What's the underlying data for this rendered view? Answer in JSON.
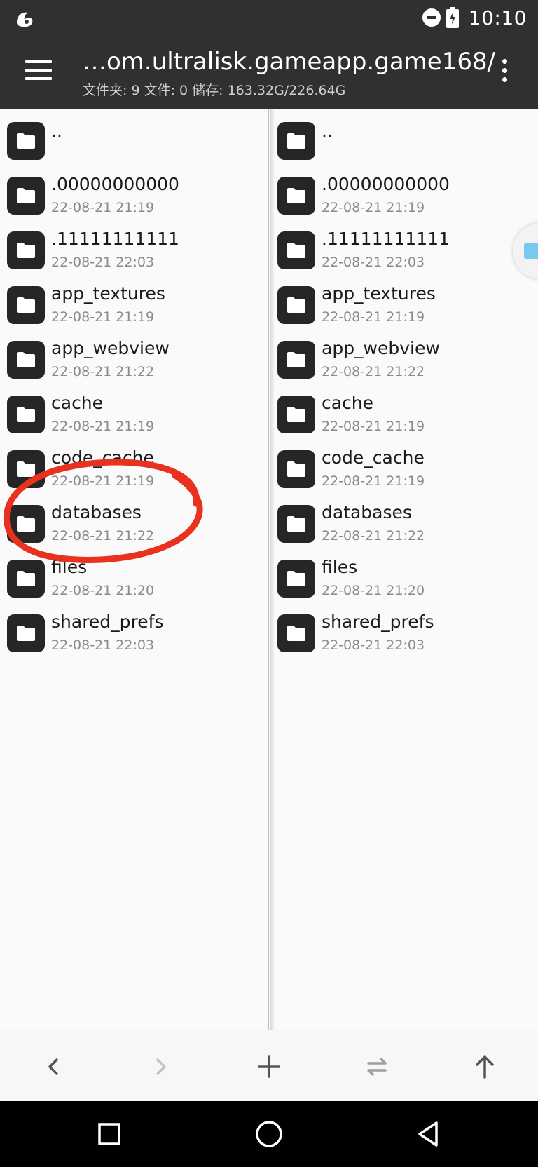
{
  "status_bar": {
    "time": "10:10",
    "icons": [
      "app-notification-icon",
      "do-not-disturb-icon",
      "battery-charging-icon"
    ]
  },
  "app_bar": {
    "path": "…om.ultralisk.gameapp.game168/",
    "summary": "文件夹: 9  文件: 0  储存: 163.32G/226.64G",
    "icons": [
      "menu-icon",
      "more-vert-icon"
    ]
  },
  "left_pane": {
    "items": [
      {
        "name": "..",
        "date": ""
      },
      {
        "name": ".00000000000",
        "date": "22-08-21 21:19"
      },
      {
        "name": ".11111111111",
        "date": "22-08-21 22:03"
      },
      {
        "name": "app_textures",
        "date": "22-08-21 21:19"
      },
      {
        "name": "app_webview",
        "date": "22-08-21 21:22"
      },
      {
        "name": "cache",
        "date": "22-08-21 21:19"
      },
      {
        "name": "code_cache",
        "date": "22-08-21 21:19"
      },
      {
        "name": "databases",
        "date": "22-08-21 21:22"
      },
      {
        "name": "files",
        "date": "22-08-21 21:20"
      },
      {
        "name": "shared_prefs",
        "date": "22-08-21 22:03"
      }
    ]
  },
  "right_pane": {
    "items": [
      {
        "name": "..",
        "date": ""
      },
      {
        "name": ".00000000000",
        "date": "22-08-21 21:19"
      },
      {
        "name": ".11111111111",
        "date": "22-08-21 22:03"
      },
      {
        "name": "app_textures",
        "date": "22-08-21 21:19"
      },
      {
        "name": "app_webview",
        "date": "22-08-21 21:22"
      },
      {
        "name": "cache",
        "date": "22-08-21 21:19"
      },
      {
        "name": "code_cache",
        "date": "22-08-21 21:19"
      },
      {
        "name": "databases",
        "date": "22-08-21 21:22"
      },
      {
        "name": "files",
        "date": "22-08-21 21:20"
      },
      {
        "name": "shared_prefs",
        "date": "22-08-21 22:03"
      }
    ]
  },
  "toolbar": {
    "icons": [
      "back-icon",
      "forward-icon",
      "add-icon",
      "swap-icon",
      "up-icon"
    ]
  },
  "navigation": {
    "icons": [
      "recents-icon",
      "home-icon",
      "back-triangle-icon"
    ]
  },
  "colors": {
    "app_bar": "#303030",
    "folder_icon": "#262626",
    "annotation": "#e8321f",
    "background": "#fafafa"
  }
}
